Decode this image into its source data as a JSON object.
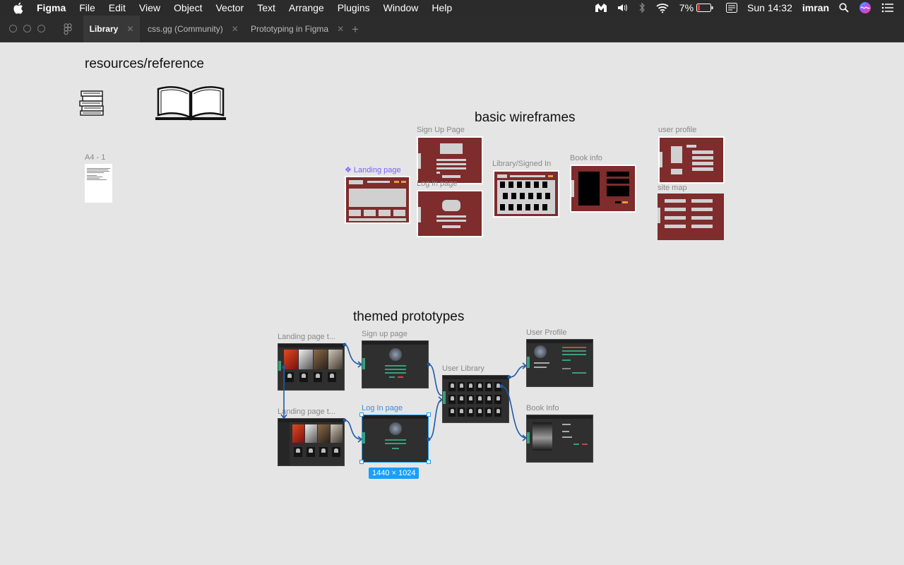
{
  "menubar": {
    "app": "Figma",
    "items": [
      "File",
      "Edit",
      "View",
      "Object",
      "Vector",
      "Text",
      "Arrange",
      "Plugins",
      "Window",
      "Help"
    ],
    "battery": "7%",
    "clock": "Sun 14:32",
    "user": "imran"
  },
  "tabs": [
    {
      "label": "Library"
    },
    {
      "label": "css.gg (Community)"
    },
    {
      "label": "Prototyping in Figma"
    }
  ],
  "canvas": {
    "resources_title": "resources/reference",
    "a4_label": "A4 - 1",
    "wireframes_title": "basic wireframes",
    "wireframes": {
      "landing": "Landing page",
      "signup": "Sign Up Page",
      "login": "Log in page",
      "library": "Library/Signed In",
      "bookinfo": "Book info",
      "userprofile": "user profile",
      "sitemap": "site map"
    },
    "prototypes_title": "themed prototypes",
    "prototypes": {
      "landing1": "Landing page t...",
      "landing2": "Landing page t...",
      "signup": "Sign up page",
      "login": "Log In page",
      "library": "User Library",
      "profile": "User Profile",
      "bookinfo": "Book Info"
    },
    "selection_size": "1440 × 1024"
  },
  "colors": {
    "canvas_bg": "#e5e5e5",
    "wireframe_fill": "#7e2c2c",
    "selection": "#18a0fb",
    "component_label": "#7b61ff",
    "prototype_accent": "#3a9e7a"
  }
}
